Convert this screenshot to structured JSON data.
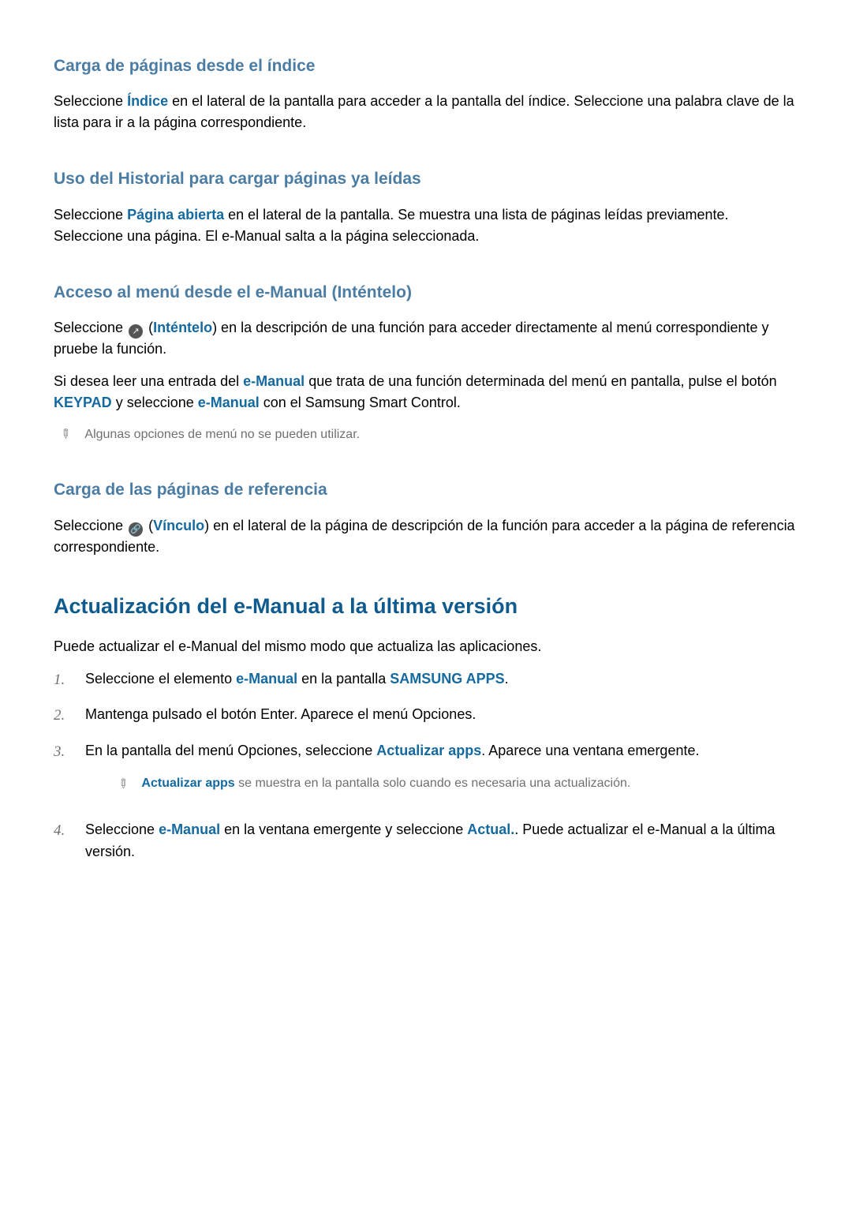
{
  "section1": {
    "heading": "Carga de páginas desde el índice",
    "para": {
      "pre": "Seleccione ",
      "link": "Índice",
      "post": " en el lateral de la pantalla para acceder a la pantalla del índice. Seleccione una palabra clave de la lista para ir a la página correspondiente."
    }
  },
  "section2": {
    "heading": "Uso del Historial para cargar páginas ya leídas",
    "para": {
      "pre": "Seleccione ",
      "link": "Página abierta",
      "post": " en el lateral de la pantalla. Se muestra una lista de páginas leídas previamente. Seleccione una página. El e-Manual salta a la página seleccionada."
    }
  },
  "section3": {
    "heading": "Acceso al menú desde el e-Manual (Inténtelo)",
    "para1": {
      "pre": "Seleccione ",
      "icon": "↗",
      "open": " (",
      "link": "Inténtelo",
      "post": ") en la descripción de una función para acceder directamente al menú correspondiente y pruebe la función."
    },
    "para2": {
      "t1": "Si desea leer una entrada del ",
      "l1": "e-Manual",
      "t2": " que trata de una función determinada del menú en pantalla, pulse el botón ",
      "l2": "KEYPAD",
      "t3": " y seleccione ",
      "l3": "e-Manual",
      "t4": " con el Samsung Smart Control."
    },
    "note": "Algunas opciones de menú no se pueden utilizar.",
    "pencil": "✎"
  },
  "section4": {
    "heading": "Carga de las páginas de referencia",
    "para": {
      "pre": "Seleccione ",
      "icon": "🔗",
      "open": " (",
      "link": "Vínculo",
      "post": ") en el lateral de la página de descripción de la función para acceder a la página de referencia correspondiente."
    }
  },
  "section5": {
    "heading": "Actualización del e-Manual a la última versión",
    "intro": "Puede actualizar el e-Manual del mismo modo que actualiza las aplicaciones.",
    "items": [
      {
        "t1": "Seleccione el elemento ",
        "l1": "e-Manual",
        "t2": " en la pantalla ",
        "l2": "SAMSUNG APPS",
        "t3": "."
      },
      {
        "t1": "Mantenga pulsado el botón Enter. Aparece el menú Opciones."
      },
      {
        "t1": "En la pantalla del menú Opciones, seleccione ",
        "l1": "Actualizar apps",
        "t2": ". Aparece una ventana emergente.",
        "note": {
          "l": "Actualizar apps",
          "t": " se muestra en la pantalla solo cuando es necesaria una actualización."
        }
      },
      {
        "t1": "Seleccione ",
        "l1": "e-Manual",
        "t2": " en la ventana emergente y seleccione ",
        "l2": "Actual.",
        "t3": ". Puede actualizar el e-Manual a la última versión."
      }
    ],
    "pencil": "✎"
  }
}
